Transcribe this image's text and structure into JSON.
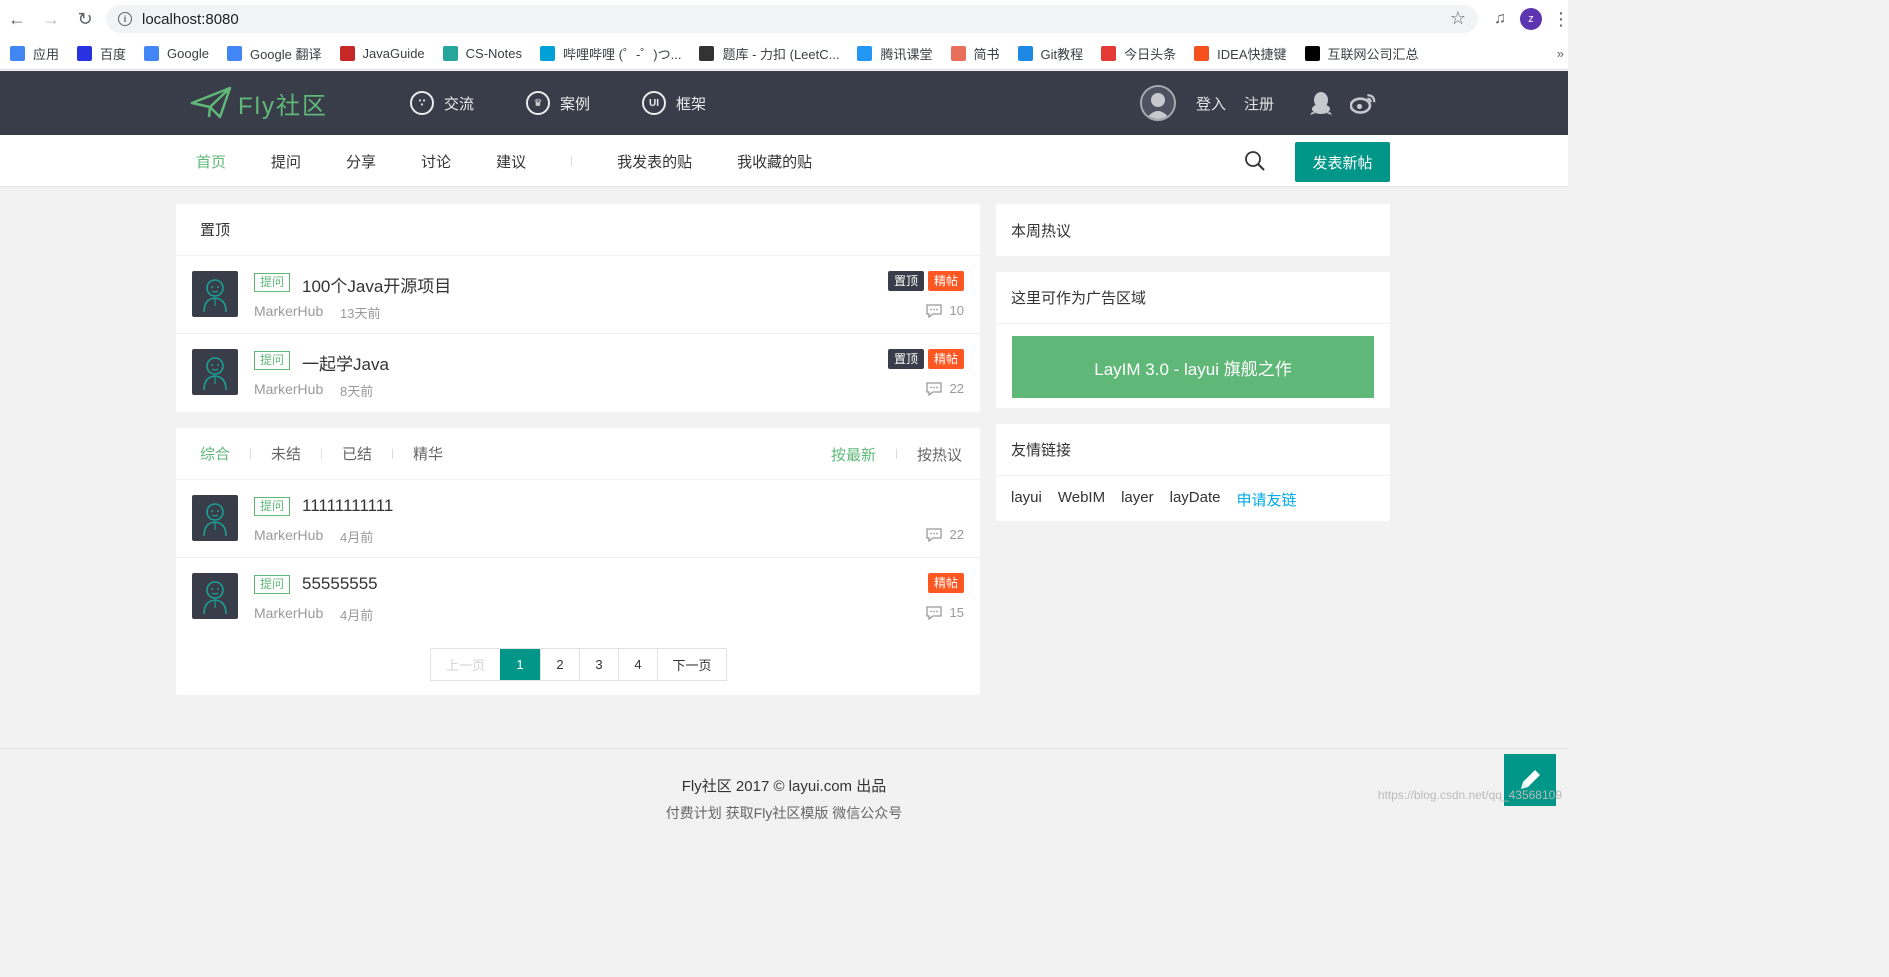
{
  "browser": {
    "url": "localhost:8080",
    "profile_initial": "z",
    "bookmarks": [
      {
        "label": "应用",
        "icon": "apps-grid-icon",
        "color": "#4285f4"
      },
      {
        "label": "百度",
        "icon": "baidu-paw-icon",
        "color": "#2932e1"
      },
      {
        "label": "Google",
        "icon": "google-g-icon",
        "color": "#4285f4"
      },
      {
        "label": "Google 翻译",
        "icon": "google-translate-icon",
        "color": "#4285f4"
      },
      {
        "label": "JavaGuide",
        "icon": "javaguide-icon",
        "color": "#c62828"
      },
      {
        "label": "CS-Notes",
        "icon": "cs-notes-icon",
        "color": "#26a69a"
      },
      {
        "label": "哔哩哔哩 (゜-゜)つ...",
        "icon": "bilibili-tv-icon",
        "color": "#00a1d6"
      },
      {
        "label": "题库 - 力扣 (LeetC...",
        "icon": "leetcode-icon",
        "color": "#333333"
      },
      {
        "label": "腾讯课堂",
        "icon": "tencent-classroom-icon",
        "color": "#2196f3"
      },
      {
        "label": "简书",
        "icon": "jianshu-icon",
        "color": "#ea6f5a"
      },
      {
        "label": "Git教程",
        "icon": "rocket-icon",
        "color": "#1e88e5"
      },
      {
        "label": "今日头条",
        "icon": "toutiao-icon",
        "color": "#e53935"
      },
      {
        "label": "IDEA快捷键",
        "icon": "csdn-c-icon",
        "color": "#f4511e"
      },
      {
        "label": "互联网公司汇总",
        "icon": "idea-icon",
        "color": "#000000"
      }
    ]
  },
  "header": {
    "logo_text": "Fly社区",
    "nav": [
      {
        "label": "交流",
        "icon": "chat-bubble-icon"
      },
      {
        "label": "案例",
        "icon": "crown-icon"
      },
      {
        "label": "框架",
        "icon": "ui-hexagon-icon"
      }
    ],
    "login": "登入",
    "register": "注册"
  },
  "subnav": {
    "items": [
      "首页",
      "提问",
      "分享",
      "讨论",
      "建议"
    ],
    "user_items": [
      "我发表的贴",
      "我收藏的贴"
    ],
    "post_button": "发表新帖"
  },
  "pinned": {
    "title": "置顶",
    "posts": [
      {
        "tag": "提问",
        "title": "100个Java开源项目",
        "author": "MarkerHub",
        "time": "13天前",
        "badges": [
          "置顶",
          "精帖"
        ],
        "comments": "10"
      },
      {
        "tag": "提问",
        "title": "一起学Java",
        "author": "MarkerHub",
        "time": "8天前",
        "badges": [
          "置顶",
          "精帖"
        ],
        "comments": "22"
      }
    ]
  },
  "list": {
    "filters": [
      "综合",
      "未结",
      "已结",
      "精华"
    ],
    "sorts": [
      "按最新",
      "按热议"
    ],
    "posts": [
      {
        "tag": "提问",
        "title": "11111111111",
        "author": "MarkerHub",
        "time": "4月前",
        "badges": [],
        "comments": "22"
      },
      {
        "tag": "提问",
        "title": "55555555",
        "author": "MarkerHub",
        "time": "4月前",
        "badges": [
          "精帖"
        ],
        "comments": "15"
      }
    ],
    "pager": {
      "prev": "上一页",
      "pages": [
        "1",
        "2",
        "3",
        "4"
      ],
      "current": "1",
      "next": "下一页"
    }
  },
  "sidebar": {
    "hot_title": "本周热议",
    "ad_title": "这里可作为广告区域",
    "ad_text": "LayIM 3.0 - layui 旗舰之作",
    "links_title": "友情链接",
    "links": [
      "layui",
      "WebIM",
      "layer",
      "layDate"
    ],
    "apply_link": "申请友链"
  },
  "footer": {
    "line1": "Fly社区   2017 ©   layui.com 出品",
    "line2": "付费计划  获取Fly社区模版  微信公众号",
    "watermark": "https://blog.csdn.net/qq_43568109"
  },
  "colors": {
    "header_bg": "#393d49",
    "accent_green": "#5fb878",
    "teal": "#009688",
    "hot_orange": "#ff5722",
    "link_blue": "#01aaed"
  }
}
